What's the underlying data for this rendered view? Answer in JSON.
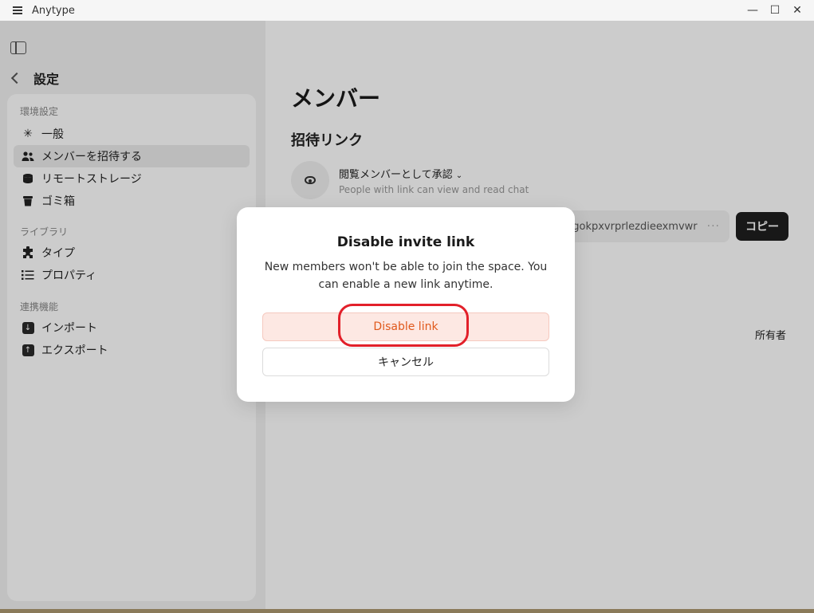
{
  "window": {
    "title": "Anytype",
    "controls": {
      "minimize": "—",
      "maximize": "☐",
      "close": "✕"
    }
  },
  "sidebar": {
    "back_title": "設定",
    "sections": [
      {
        "label": "環境設定",
        "items": [
          {
            "label": "一般",
            "icon": "asterisk-icon"
          },
          {
            "label": "メンバーを招待する",
            "icon": "users-icon",
            "active": true
          },
          {
            "label": "リモートストレージ",
            "icon": "database-icon"
          },
          {
            "label": "ゴミ箱",
            "icon": "trash-icon"
          }
        ]
      },
      {
        "label": "ライブラリ",
        "items": [
          {
            "label": "タイプ",
            "icon": "puzzle-icon"
          },
          {
            "label": "プロパティ",
            "icon": "list-icon"
          }
        ]
      },
      {
        "label": "連携機能",
        "items": [
          {
            "label": "インポート",
            "icon": "import-icon"
          },
          {
            "label": "エクスポート",
            "icon": "export-icon"
          }
        ]
      }
    ]
  },
  "main": {
    "title": "メンバー",
    "invite_section": "招待リンク",
    "invite_mode": "閲覧メンバーとして承認",
    "invite_mode_desc": "People with link can view and read chat",
    "link_text": "gokpxvrprlezdieexmvwr",
    "copy_label": "コピー",
    "owner_label": "所有者"
  },
  "modal": {
    "title": "Disable invite link",
    "description": "New members won't be able to join the space. You can enable a new link anytime.",
    "disable_label": "Disable link",
    "cancel_label": "キャンセル"
  },
  "colors": {
    "danger_text": "#e0591c",
    "danger_bg": "#fde8e3",
    "highlight": "#e2202a",
    "copy_bg": "#1f1f1f"
  }
}
